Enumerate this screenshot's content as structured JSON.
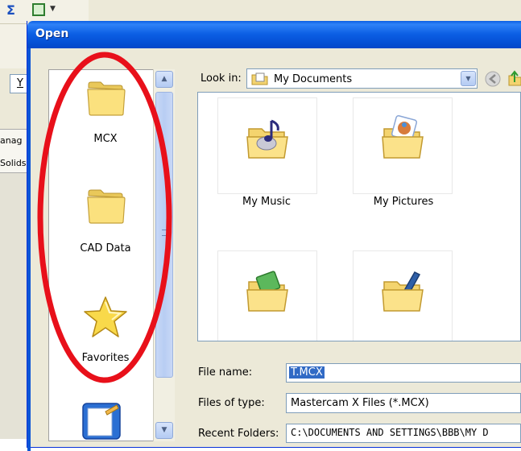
{
  "dialog": {
    "title": "Open"
  },
  "background": {
    "y_field": "Y",
    "tab_manager": "anag",
    "tab_solids": "Solids"
  },
  "places": [
    {
      "label": "MCX",
      "icon": "folder-icon"
    },
    {
      "label": "CAD Data",
      "icon": "folder-icon"
    },
    {
      "label": "Favorites",
      "icon": "star-icon"
    },
    {
      "label": "",
      "icon": "notepad-icon"
    }
  ],
  "lookin": {
    "label": "Look in:",
    "value": "My Documents"
  },
  "files": [
    {
      "label": "My Music",
      "icon": "music-folder-icon"
    },
    {
      "label": "My Pictures",
      "icon": "pictures-folder-icon"
    },
    {
      "label": "",
      "icon": "video-folder-icon"
    },
    {
      "label": "",
      "icon": "pen-folder-icon"
    }
  ],
  "fields": {
    "filename_label": "File name:",
    "filename_value": "T.MCX",
    "filetype_label": "Files of type:",
    "filetype_value": "Mastercam X Files (*.MCX)",
    "recent_label": "Recent Folders:",
    "recent_value": "C:\\DOCUMENTS AND SETTINGS\\BBB\\MY D"
  },
  "colors": {
    "titlebar": "#0551d6",
    "annotation": "#e8101a",
    "selection": "#316ac5"
  }
}
